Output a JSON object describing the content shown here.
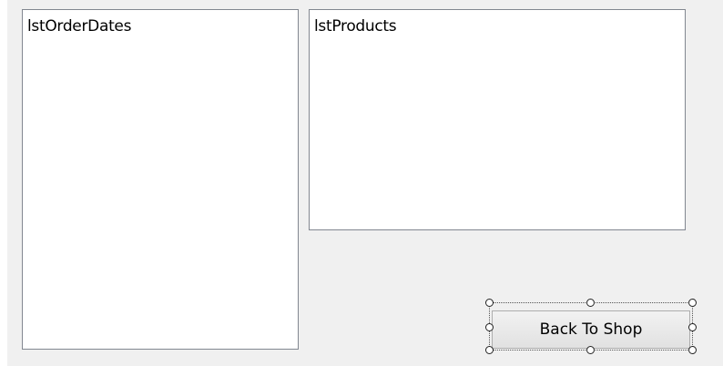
{
  "form": {
    "list_order_dates": {
      "name": "lstOrderDates"
    },
    "list_products": {
      "name": "lstProducts"
    },
    "back_button": {
      "label": "Back To Shop",
      "selected_in_designer": true
    }
  },
  "colors": {
    "form_background": "#f0f0f0",
    "listbox_border": "#828790",
    "button_border": "#adadad"
  }
}
